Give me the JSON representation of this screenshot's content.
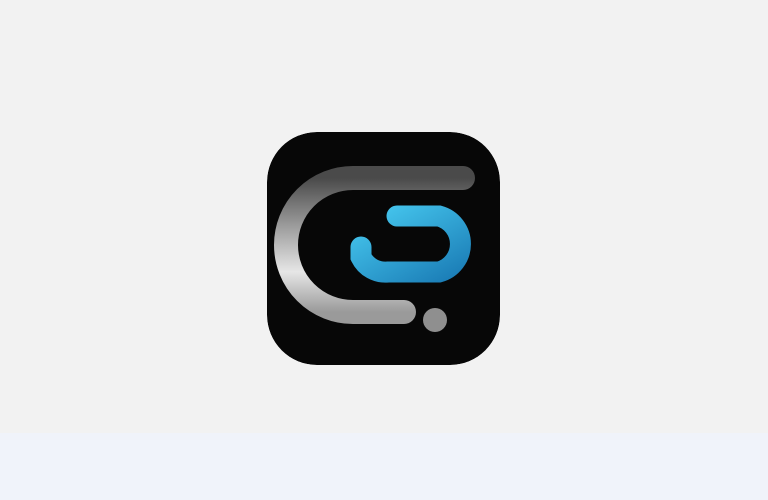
{
  "colors": {
    "background": "#f2f2f2",
    "footer_band": "#f0f3fa",
    "icon_background": "#070707",
    "metal_light": "#e6e6e6",
    "metal_mid": "#9a9a9a",
    "metal_dark": "#4a4a4a",
    "accent_light": "#46c7ee",
    "accent_dark": "#1c7fb8",
    "dot": "#8f8f8f"
  },
  "icon": {
    "name": "app-logo-icon"
  }
}
